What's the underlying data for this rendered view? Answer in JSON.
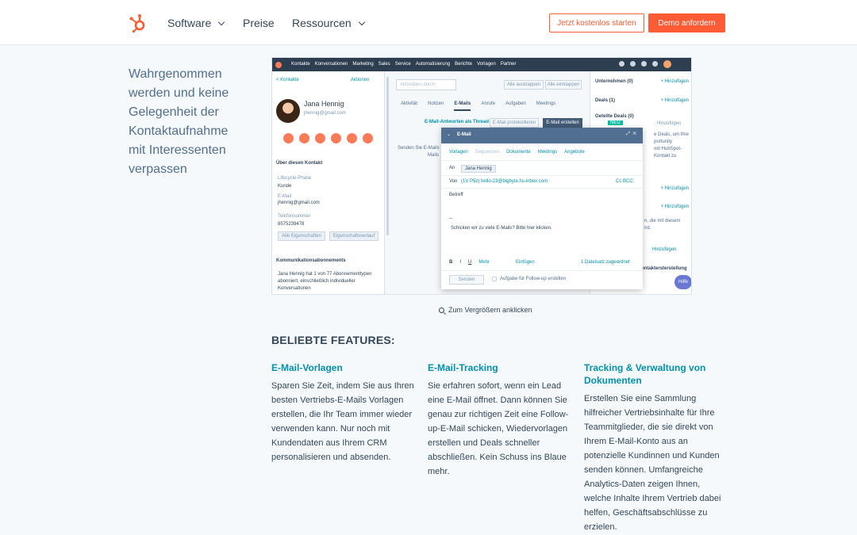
{
  "header": {
    "nav": [
      {
        "label": "Software",
        "dropdown": true
      },
      {
        "label": "Preise",
        "dropdown": false
      },
      {
        "label": "Ressourcen",
        "dropdown": true
      }
    ],
    "cta_outline": "Jetzt kostenlos starten",
    "cta_solid": "Demo anfordern"
  },
  "intro": "Wahrgenommen werden und keine Gelegenheit der Kontaktaufnahme mit Interessenten verpassen",
  "screenshot": {
    "menu": [
      "Kontakte",
      "Konversationen",
      "Marketing",
      "Sales",
      "Service",
      "Automatisierung",
      "Berichte",
      "Vorlagen",
      "Partner"
    ],
    "back_link": "< Kontakte",
    "actions": "Aktionen",
    "contact_name": "Jana Hennig",
    "contact_email": "jhennig@gmail.com",
    "about_heading": "Über diesen Kontakt",
    "lifecycle_label": "Lifecycle-Phase",
    "lifecycle_value": "Kunde",
    "email_label": "E-Mail",
    "email_value": "jhennig@gmail.com",
    "phone_label": "Telefonnummer",
    "phone_value": "8575239478",
    "btn_all_props": "Alle Eigenschaften",
    "btn_prop_history": "Eigenschaftsverlauf",
    "subs_heading": "Kommunikationsabonnements",
    "subs_text": "Jana Hennig hat 1 von 77 Abonnementtypen abonniert, einschließlich individueller Konversationen",
    "search_placeholder": "Aktivitäten durch",
    "collapse_all": "Alle ausklappen",
    "expand_all": "Alle einklappen",
    "tabs": [
      "Aktivität",
      "Notizen",
      "E-Mails",
      "Anrufe",
      "Aufgaben",
      "Meetings"
    ],
    "active_tab": "E-Mails",
    "reply_thread": "E-Mail-Antworten als Thread",
    "btn_log_email": "E-Mail protokollieren",
    "btn_create_email": "E-Mail erstellen",
    "mid_text": "Senden Sie E-Mails",
    "mid_text2": "Mails",
    "right": {
      "companies": "Unternehmen (0)",
      "deals": "Deals (1)",
      "shared_deals": "Geteilte Deals (0)",
      "new_badge": "NEU",
      "add": "+ Hinzufügen",
      "add_plain": "Hinzufügen",
      "text1": "e Deals, um Ihre",
      "text2": "portunity",
      "text3": "mit HubSpot-",
      "text4": "Kontakt zu",
      "text5": "n, die mit diesem",
      "text6": "ird.",
      "add_dropdown": "Hinzufügen",
      "contact_creation": "ontaktersterstellung",
      "help": "Hilfe"
    },
    "modal": {
      "title": "E-Mail",
      "toolbar": [
        "Vorlagen",
        "Sequenzen",
        "Dokumente",
        "Meetings",
        "Angebote"
      ],
      "to_label": "An",
      "to_chip": "Jana Hennig",
      "from_label": "Von",
      "from_value": "(1V P5z) hello-23@bigbyte.hs-inbox.com",
      "cc_bcc": "Cc  BCC",
      "subject": "Betreff",
      "signature_dash": "--",
      "body": "Schicken wir zu viele E-Mails? Bitte hier klicken.",
      "format_more": "Mehr",
      "insert": "Einfügen",
      "files_attached": "1 Dateisatz zugeordnet",
      "send": "Senden",
      "followup": "Aufgabe für Follow-up erstellen"
    }
  },
  "zoom_hint": "Zum Vergrößern anklicken",
  "features_heading": "BELIEBTE FEATURES:",
  "features": [
    {
      "title": "E-Mail-Vorlagen",
      "text": "Sparen Sie Zeit, indem Sie aus Ihren besten Vertriebs-E-Mails Vorlagen erstellen, die Ihr Team immer wieder verwenden kann. Nur noch mit Kundendaten aus Ihrem CRM personalisieren und absenden."
    },
    {
      "title": "E-Mail-Tracking",
      "text": "Sie erfahren sofort, wenn ein Lead eine E-Mail öffnet. Dann können Sie genau zur richtigen Zeit eine Follow-up-E-Mail schicken, Wiedervorlagen erstellen und Deals schneller abschließen. Kein Schuss ins Blaue mehr."
    },
    {
      "title": "Tracking & Verwaltung von Dokumenten",
      "text": "Erstellen Sie eine Sammlung hilfreicher Vertriebsinhalte für Ihre Teammitglieder, die sie direkt von Ihrem E-Mail-Konto aus an potenzielle Kundinnen und Kunden senden können. Umfangreiche Analytics-Daten zeigen Ihnen, welche Inhalte Ihrem Vertrieb dabei helfen, Geschäftsabschlüsse zu erzielen."
    }
  ],
  "colors": {
    "brand": "#ff5c35",
    "link": "#0091ae",
    "text": "#33475b"
  }
}
